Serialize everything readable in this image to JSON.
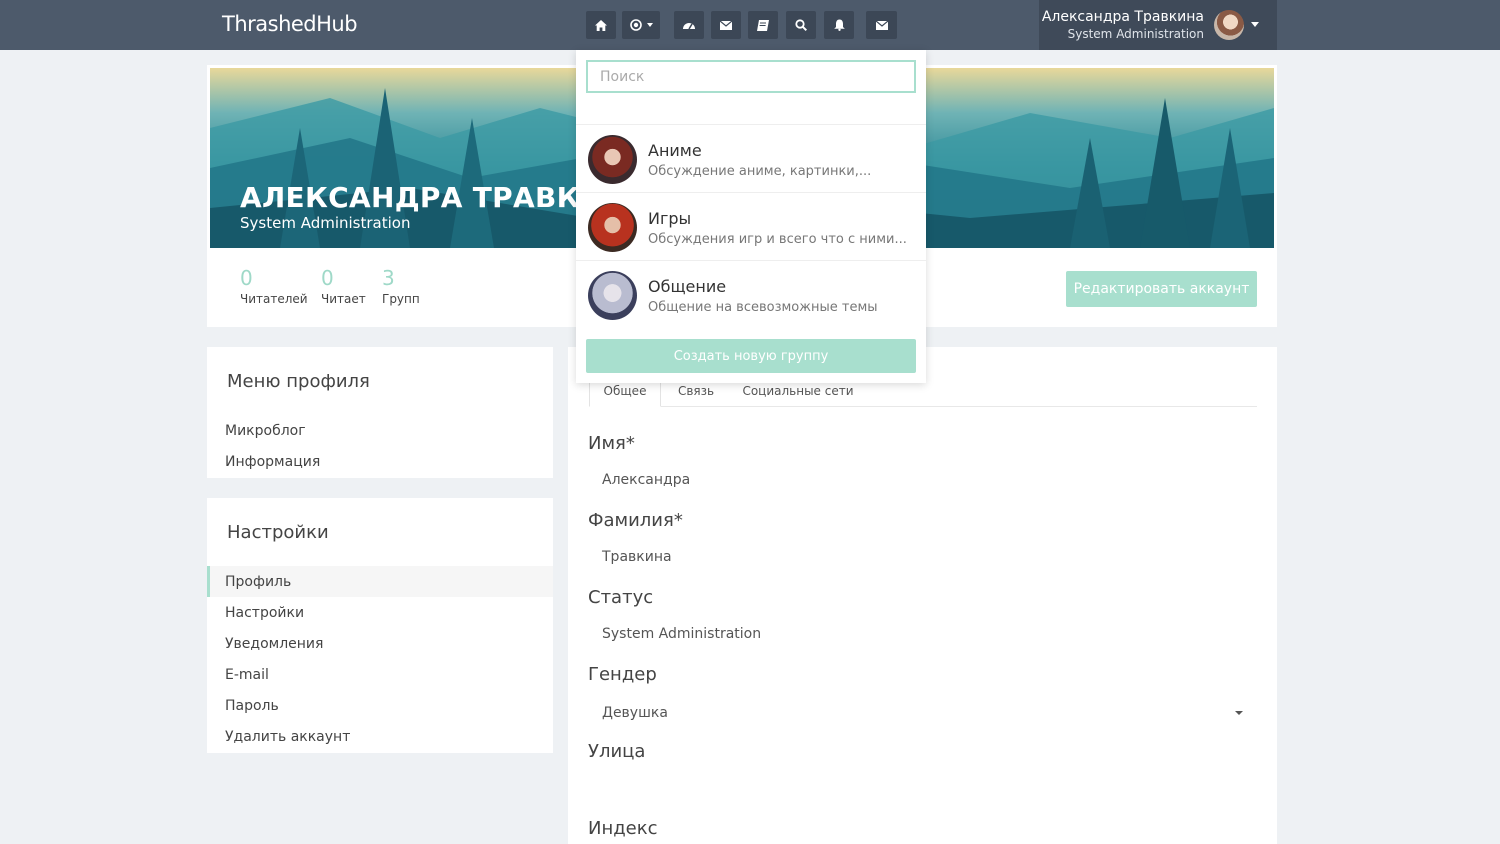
{
  "app": {
    "brand": "ThrashedHub"
  },
  "topnav": {
    "icons": [
      "home-icon",
      "record-icon",
      "dashboard-icon",
      "envelope-icon",
      "book-icon",
      "search-icon",
      "bell-icon",
      "envelope-icon"
    ]
  },
  "user": {
    "name": "Александра Травкина",
    "role": "System Administration"
  },
  "profile": {
    "name": "АЛЕКСАНДРА ТРАВКИНА",
    "role": "System Administration",
    "stats": [
      {
        "value": "0",
        "label": "Читателей"
      },
      {
        "value": "0",
        "label": "Читает"
      },
      {
        "value": "3",
        "label": "Групп"
      }
    ],
    "edit_label": "Редактировать аккаунт"
  },
  "groups_dropdown": {
    "search_placeholder": "Поиск",
    "items": [
      {
        "title": "Аниме",
        "desc": "Обсуждение аниме, картинки,..."
      },
      {
        "title": "Игры",
        "desc": "Обсуждения игр и всего что с ними..."
      },
      {
        "title": "Общение",
        "desc": "Общение на всевозможные темы"
      }
    ],
    "create_label": "Создать новую группу"
  },
  "profile_menu": {
    "title": "Меню профиля",
    "items": [
      "Микроблог",
      "Информация"
    ]
  },
  "settings_menu": {
    "title": "Настройки",
    "items": [
      "Профиль",
      "Настройки",
      "Уведомления",
      "E-mail",
      "Пароль",
      "Удалить аккаунт"
    ]
  },
  "form": {
    "tabs": [
      "Общее",
      "Связь",
      "Социальные сети"
    ],
    "fields": [
      {
        "label": "Имя*",
        "value": "Александра"
      },
      {
        "label": "Фамилия*",
        "value": "Травкина"
      },
      {
        "label": "Статус",
        "value": "System Administration"
      },
      {
        "label": "Гендер",
        "value": "Девушка"
      },
      {
        "label": "Улица",
        "value": ""
      },
      {
        "label": "Индекс",
        "value": ""
      }
    ]
  },
  "colors": {
    "accent": "#a8dfce",
    "nav": "#4d5a6b",
    "background": "#eef1f4"
  }
}
